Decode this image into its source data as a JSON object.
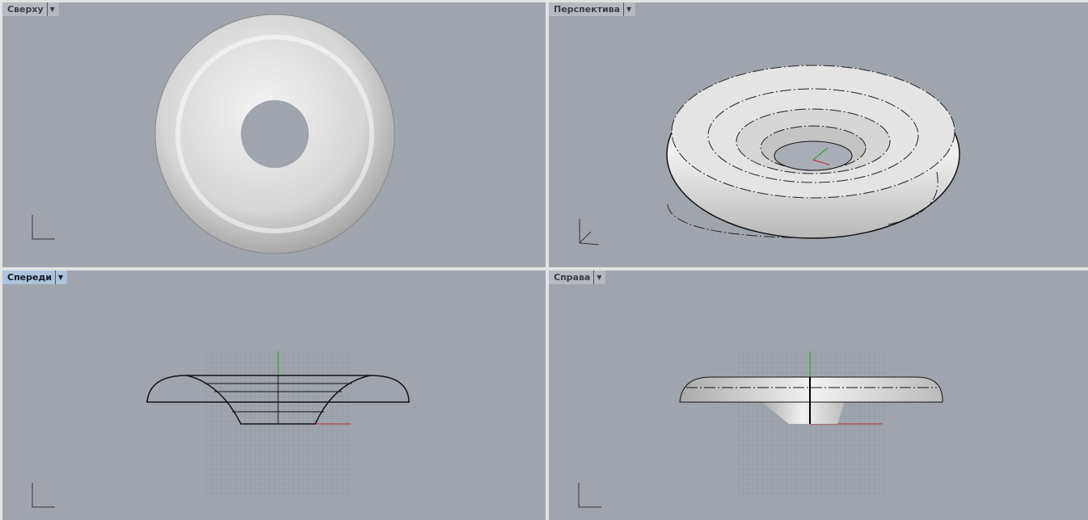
{
  "viewports": [
    {
      "title": "Сверху",
      "active": false
    },
    {
      "title": "Перспектива",
      "active": false
    },
    {
      "title": "Спереди",
      "active": true
    },
    {
      "title": "Справа",
      "active": false
    }
  ],
  "icons": {
    "dropdown": "triangle-down-icon"
  },
  "colors": {
    "background": "#a0a5ad",
    "x_axis": "#b03030",
    "y_axis": "#2a9a2a"
  }
}
